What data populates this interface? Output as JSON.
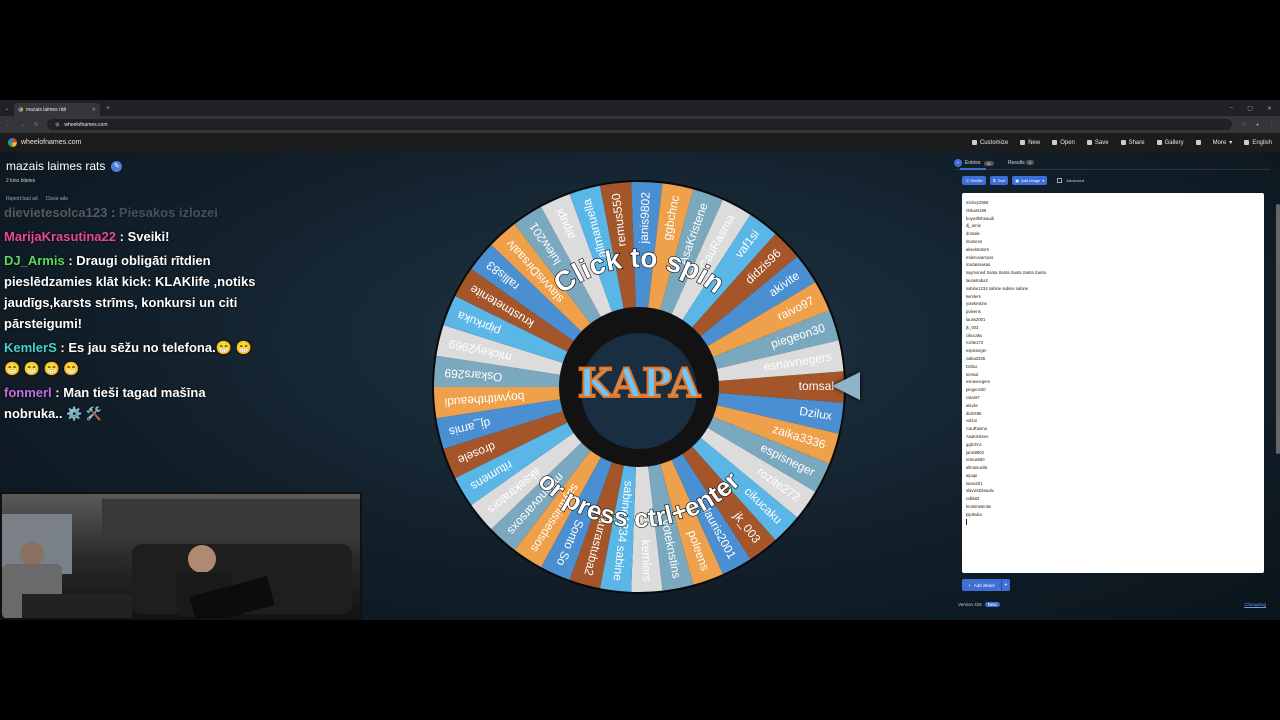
{
  "browser": {
    "tab_title": "mazais laimes rāti",
    "url": "wheelofnames.com"
  },
  "site": {
    "logo_text": "wheelofnames.com",
    "nav": [
      "Customize",
      "New",
      "Open",
      "Save",
      "Share",
      "Gallery",
      "More",
      "English"
    ]
  },
  "wheel": {
    "title": "mazais laimes rats",
    "subtitle": "2 kino biļetes",
    "report": "Report bad ad",
    "close_ads": "Close ads",
    "click_text": "Click to spin",
    "press_text": "or press ctrl+enter",
    "center_logo": "KAPA",
    "colors": [
      "#a4552a",
      "#4a8fd1",
      "#efa04a",
      "#7aa8bf",
      "#dcdcdc",
      "#5bb6e8"
    ],
    "segments": [
      "tomsal",
      "Dzilux",
      "zaika3336",
      "espisneger",
      "rozite272",
      "cikucaku",
      "jk_003",
      "lauris2001",
      "poleens",
      "yoteknstins",
      "kemlers",
      "sabine1234 sabine",
      "laurastuba2",
      "Sonto So",
      "sayanissedsos",
      "mdenovarsoxs",
      "aksektrators",
      "ritumens",
      "drosele",
      "dj_arnis",
      "boywiththeaudi",
      "Oskars269",
      "mickey2969",
      "piprkuka",
      "krustmetenite",
      "rallis83",
      "slavvisDirsaalv",
      "luiew201",
      "aipupi",
      "allmanuella",
      "remus550",
      "janis9802",
      "ggbchnc",
      "AsaKristene",
      "CauRasma",
      "vaf1si",
      "didzis96",
      "akivite",
      "raivo97",
      "piegeon30",
      "esnavnegers"
    ]
  },
  "chat": [
    {
      "user": "dievietesolca123",
      "text": "Piesakos izlozei",
      "color": "#cfcfcf",
      "faded": true
    },
    {
      "user": "MarijaKrasutina22",
      "text": "Sveiki!",
      "color": "#e84a9a",
      "faded": false
    },
    {
      "user": "DJ_Armis",
      "text": "Draugi obligāti rītdien pieslēdzamies klāt kick: KLAKlife ,notiks jaudīgs,karsts strīms, konkursi un citi pārsteigumi!",
      "color": "#5cd85c",
      "faded": false
    },
    {
      "user": "KemlerS",
      "text": "Es jau sēžu no telefona.😁 😁 😁 😁 😁 😁",
      "color": "#42d3c8",
      "faded": false
    },
    {
      "user": "fonmerl",
      "text": "Man tieši tagad mašīna nobruka.. ⚙️ 🛠️",
      "color": "#c46ee0",
      "faded": false
    }
  ],
  "panel": {
    "tab_entries": "Entries",
    "entries_count": "41",
    "tab_results": "Results",
    "results_count": "0",
    "shuffle": "Shuffle",
    "sort": "Sort",
    "add_image": "Add image",
    "advanced": "Advanced",
    "add_wheel": "Add wheel",
    "version": "Version 425",
    "new_badge": "New",
    "changelog": "Changelog",
    "entries": [
      "mickey2969",
      "Oskars269",
      "boywiththeaudi",
      "dj_arnis",
      "drosale",
      "ritumens",
      "aksektrators",
      "mdenovarsoxs",
      "mazaissasas",
      "saymoned Santa Santa Santa Santa Santa",
      "laurastuba2",
      "sabine1234 sabine sabine sabine",
      "kemlers",
      "yoteknstins",
      "poleens",
      "lauris2001",
      "jk_003",
      "cikucaku",
      "rozite272",
      "espisneger",
      "zaika3336",
      "Dzilux",
      "tomsai",
      "esnavnegers",
      "piegeon30",
      "raivo97",
      "akivite",
      "didzis96",
      "vaf1si",
      "CauRasma",
      "AsaKristene",
      "ggbchnc",
      "janis9802",
      "remus550",
      "allmanuella",
      "aipupi",
      "luiew201",
      "slavvisDirsaalv",
      "rallis83",
      "krustmetenite",
      "piprkuka"
    ]
  }
}
